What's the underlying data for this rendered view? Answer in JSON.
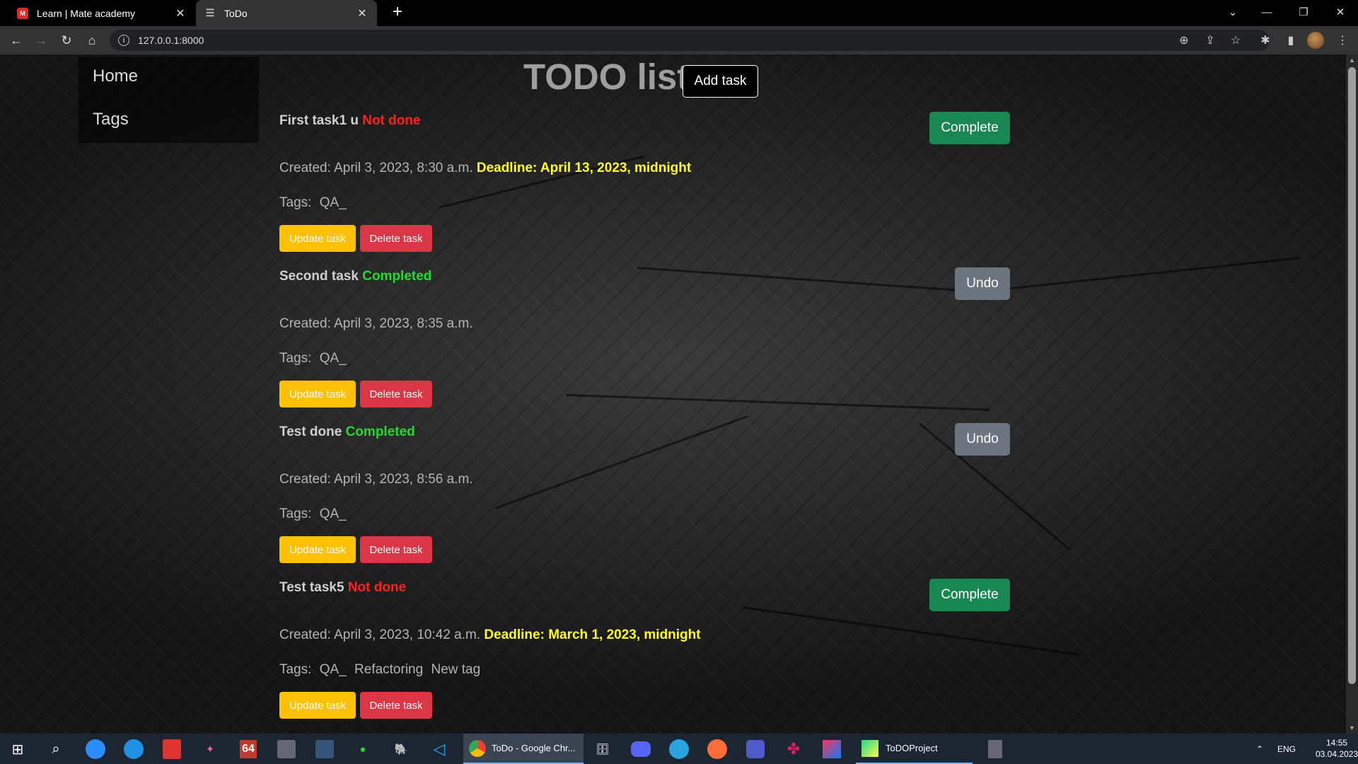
{
  "browser": {
    "tabs": [
      {
        "title": "Learn | Mate academy",
        "favicon": "mate-academy-icon",
        "active": false
      },
      {
        "title": "ToDo",
        "favicon": "todo-list-icon",
        "active": true
      }
    ],
    "new_tab": "+",
    "address": "127.0.0.1:8000",
    "info_glyph": "i"
  },
  "sidebar": {
    "items": [
      {
        "label": "Home"
      },
      {
        "label": "Tags"
      }
    ]
  },
  "header": {
    "title": "TODO list",
    "add_button": "Add task"
  },
  "labels": {
    "created_prefix": "Created: ",
    "tags_prefix": "Tags: ",
    "update": "Update task",
    "delete": "Delete task"
  },
  "tasks": [
    {
      "name": "First task1 u",
      "status": "Not done",
      "created": "April 3, 2023, 8:30 a.m.",
      "deadline": "Deadline: April 13, 2023, midnight",
      "tags": [
        "QA_"
      ],
      "action": "Complete"
    },
    {
      "name": "Second task",
      "status": "Completed",
      "created": "April 3, 2023, 8:35 a.m.",
      "deadline": "",
      "tags": [
        "QA_"
      ],
      "action": "Undo"
    },
    {
      "name": "Test done",
      "status": "Completed",
      "created": "April 3, 2023, 8:56 a.m.",
      "deadline": "",
      "tags": [
        "QA_"
      ],
      "action": "Undo"
    },
    {
      "name": "Test task5",
      "status": "Not done",
      "created": "April 3, 2023, 10:42 a.m.",
      "deadline": "Deadline: March 1, 2023, midnight",
      "tags": [
        "QA_",
        "Refactoring",
        "New tag"
      ],
      "action": "Complete"
    }
  ],
  "taskbar": {
    "chrome_label": "ToDo - Google Chr...",
    "pycharm_label": "ToDOProject",
    "app_64_label": "64",
    "language": "ENG",
    "time": "14:55",
    "date": "03.04.2023"
  },
  "colors": {
    "not_done": "#ff2020",
    "completed": "#1fdc2f",
    "deadline": "#ffff22",
    "complete_button": "#198754",
    "undo_button": "#6c757d",
    "update_button": "#ffc107",
    "delete_button": "#dc3545"
  }
}
